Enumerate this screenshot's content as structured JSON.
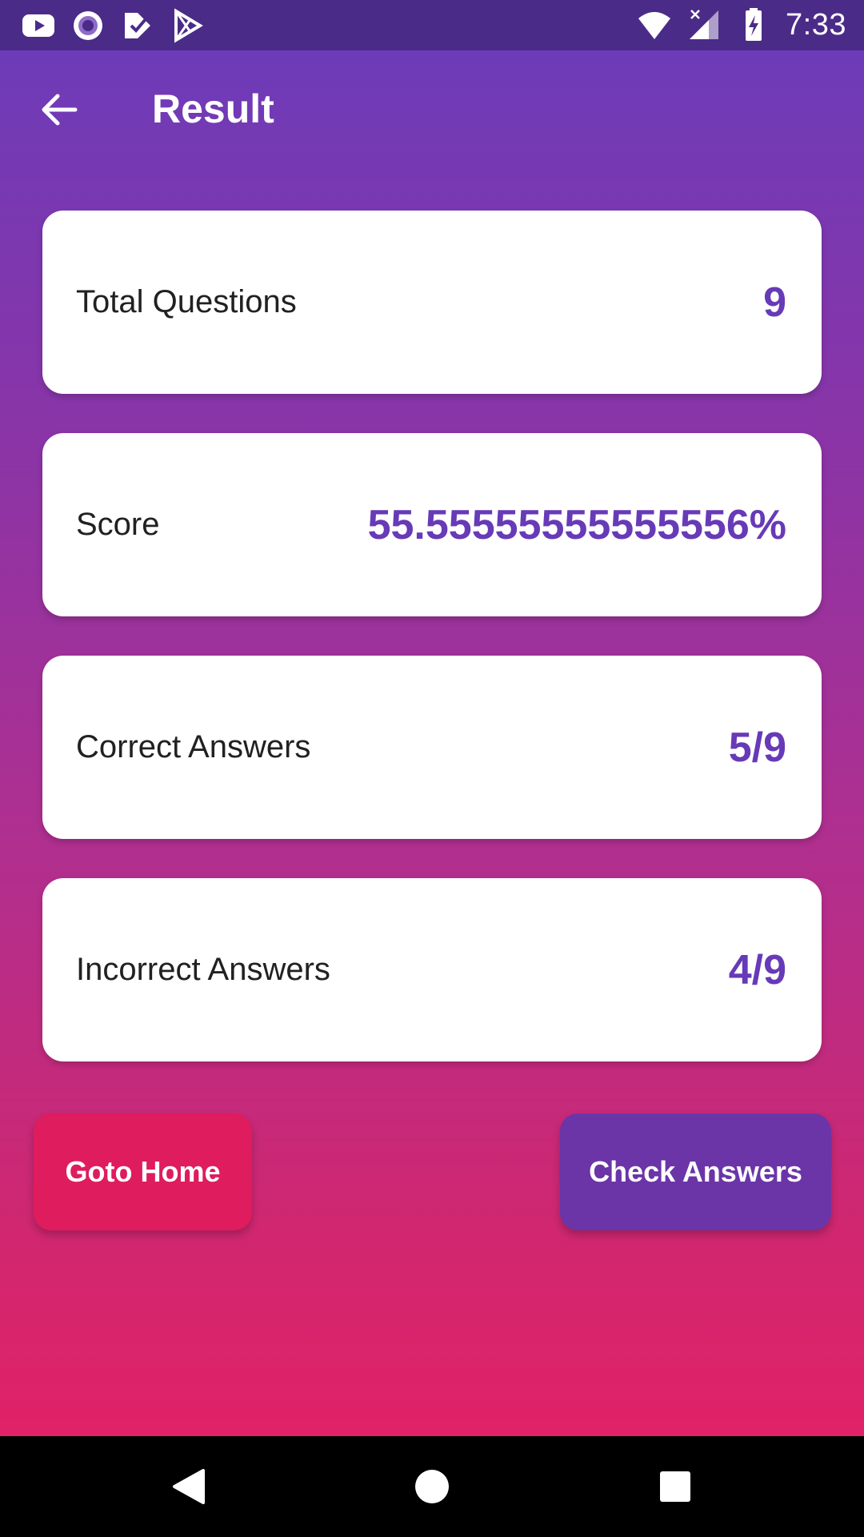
{
  "status_bar": {
    "time": "7:33",
    "left_icons": [
      "youtube-icon",
      "radio-icon",
      "task-check-icon",
      "play-store-icon"
    ],
    "right_icons": [
      "wifi-icon",
      "signal-icon",
      "battery-charging-icon"
    ]
  },
  "app_bar": {
    "title": "Result",
    "back_icon": "arrow-back-icon"
  },
  "results": [
    {
      "label": "Total Questions",
      "value": "9"
    },
    {
      "label": "Score",
      "value": "55.55555555555556%"
    },
    {
      "label": "Correct Answers",
      "value": "5/9"
    },
    {
      "label": "Incorrect Answers",
      "value": "4/9"
    }
  ],
  "buttons": {
    "home_label": "Goto Home",
    "check_label": "Check Answers"
  },
  "colors": {
    "accent": "#673ab7",
    "home_button": "#df1c5d",
    "check_button": "#6b35a8",
    "status_bar": "#4b2b88"
  },
  "nav_bar": {
    "icons": [
      "nav-back-icon",
      "nav-home-icon",
      "nav-recents-icon"
    ]
  }
}
